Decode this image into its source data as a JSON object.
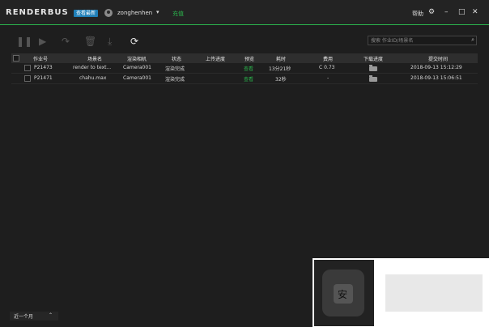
{
  "app": {
    "logo": "RENDERBUS",
    "badge": "查看最新",
    "username": "zonghenhen",
    "recharge": "充值",
    "help": "帮助"
  },
  "toolbar": {
    "search_placeholder": "搜索 作业ID/场景名"
  },
  "table": {
    "columns": [
      "作业号",
      "场景名",
      "渲染相机",
      "状态",
      "上传进度",
      "预览",
      "耗时",
      "费用",
      "下载进度",
      "提交时间"
    ],
    "rows": [
      {
        "id": "P21473",
        "scene": "render to text...",
        "camera": "Camera001",
        "status": "渲染完成",
        "upload": "",
        "preview": "查看",
        "duration": "13分21秒",
        "cost": "C 0.73",
        "download": "",
        "submit": "2018-09-13 15:12:29"
      },
      {
        "id": "P21471",
        "scene": "chahu.max",
        "camera": "Camera001",
        "status": "渲染完成",
        "upload": "",
        "preview": "查看",
        "duration": "32秒",
        "cost": "-",
        "download": "",
        "submit": "2018-09-13 15:06:51"
      }
    ]
  },
  "footer": {
    "range": "近一个月"
  },
  "watermark": {
    "glyph": "安"
  }
}
